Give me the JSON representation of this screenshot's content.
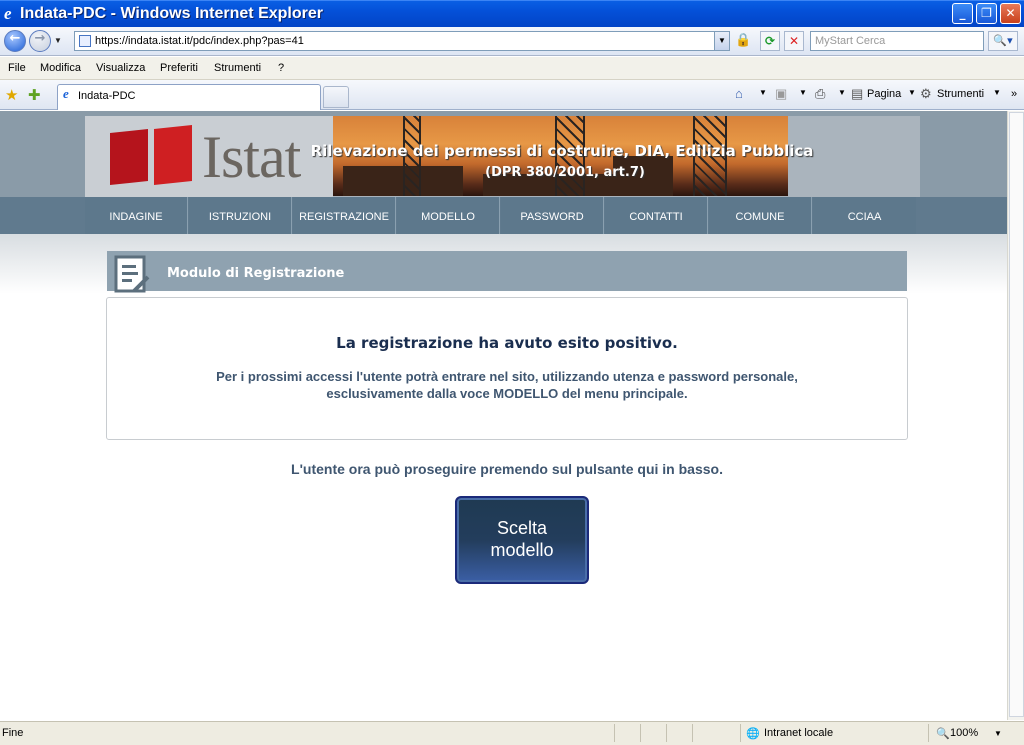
{
  "window": {
    "title": "Indata-PDC - Windows Internet Explorer"
  },
  "addressbar": {
    "url": "https://indata.istat.it/pdc/index.php?pas=41",
    "search_placeholder": "MyStart Cerca"
  },
  "menubar": {
    "items": [
      "File",
      "Modifica",
      "Visualizza",
      "Preferiti",
      "Strumenti",
      "?"
    ]
  },
  "tabs": [
    {
      "label": "Indata-PDC"
    }
  ],
  "commandbar": {
    "page_label": "Pagina",
    "tools_label": "Strumenti"
  },
  "header": {
    "logo_text": "Istat",
    "banner_title": "Rilevazione dei permessi di costruire, DIA, Edilizia Pubblica",
    "banner_subtitle": "(DPR 380/2001, art.7)"
  },
  "nav": {
    "items": [
      "INDAGINE",
      "ISTRUZIONI",
      "REGISTRAZIONE",
      "MODELLO",
      "PASSWORD",
      "CONTATTI",
      "COMUNE",
      "CCIAA"
    ]
  },
  "module": {
    "title": "Modulo di Registrazione",
    "success": "La registrazione ha avuto esito positivo.",
    "info_line1": "Per i prossimi accessi l'utente potrà entrare nel sito, utilizzando utenza e password personale,",
    "info_line2": "esclusivamente dalla voce MODELLO del menu principale.",
    "proceed_text": "L'utente ora può proseguire premendo sul pulsante qui in basso.",
    "button_line1": "Scelta",
    "button_line2": "modello"
  },
  "status": {
    "text": "Fine",
    "zone": "Intranet locale",
    "zoom": "100%"
  },
  "colors": {
    "nav_bg": "#5d788c",
    "module_header": "#8fa2b0",
    "button_bg": "#233d5c",
    "text_dark": "#1a2e4f"
  }
}
